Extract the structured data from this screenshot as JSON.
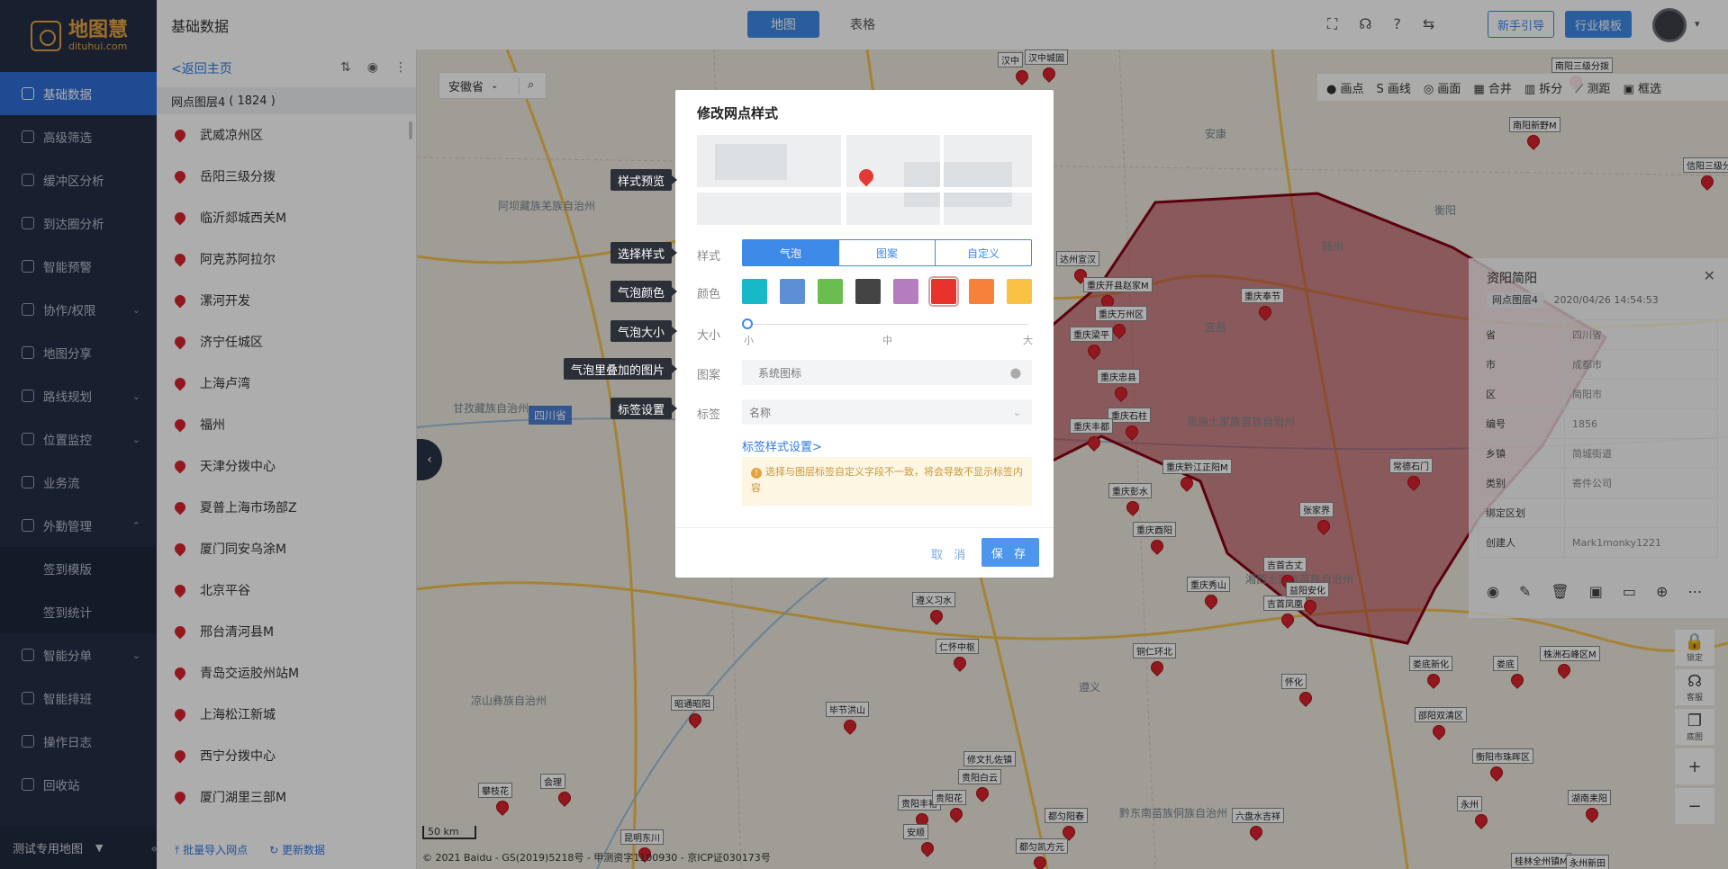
{
  "nav": {
    "logo": {
      "name": "地图慧",
      "sub": "dituhui.com"
    },
    "items": [
      {
        "label": "基础数据",
        "active": true
      },
      {
        "label": "高级筛选"
      },
      {
        "label": "缓冲区分析"
      },
      {
        "label": "到达圈分析"
      },
      {
        "label": "智能预警"
      },
      {
        "label": "协作/权限",
        "arrow": "⌄"
      },
      {
        "label": "地图分享"
      },
      {
        "label": "路线规划",
        "arrow": "⌄"
      },
      {
        "label": "位置监控",
        "arrow": "⌄"
      },
      {
        "label": "业务流"
      },
      {
        "label": "外勤管理",
        "arrow": "⌃"
      },
      {
        "label": "签到模版",
        "sub": true
      },
      {
        "label": "签到统计",
        "sub": true
      },
      {
        "label": "智能分单",
        "arrow": "⌄"
      },
      {
        "label": "智能排班"
      },
      {
        "label": "操作日志"
      },
      {
        "label": "回收站"
      }
    ],
    "map_name": "测试专用地图",
    "collapse": "«"
  },
  "topbar": {
    "title": "基础数据",
    "tabs": [
      {
        "label": "地图",
        "active": true
      },
      {
        "label": "表格"
      }
    ],
    "guide_btn": "新手引导",
    "template_btn": "行业模板"
  },
  "panel": {
    "back": "<返回主页",
    "layer_name": "网点图层4",
    "layer_count": "( 1824 )",
    "items": [
      "武威凉州区",
      "岳阳三级分拨",
      "临沂郯城西关M",
      "阿克苏阿拉尔",
      "漯河开发",
      "济宁任城区",
      "上海卢湾",
      "福州",
      "天津分拨中心",
      "夏普上海市场部Z",
      "厦门同安乌涂M",
      "北京平谷",
      "邢台清河县M",
      "青岛交运胶州站M",
      "上海松江新城",
      "西宁分拨中心",
      "厦门湖里三部M"
    ],
    "import": "批量导入网点",
    "refresh": "更新数据"
  },
  "map": {
    "province_select": "安徽省",
    "tools": [
      "画点",
      "画线",
      "画面",
      "合并",
      "拆分",
      "测距",
      "框选"
    ],
    "province_tag": "四川省",
    "region_labels": [
      "阿坝藏族羌族自治州",
      "甘孜藏族自治州",
      "凉山彝族自治州",
      "恩施土家族苗族自治州",
      "黔东南苗族侗族自治州",
      "安康",
      "湘西土家族苗族自治州",
      "随州",
      "宜昌",
      "衡阳",
      "遵义"
    ],
    "cities": [
      "汉中城固",
      "汉中",
      "达州宣汉",
      "重庆开县赵家M",
      "重庆奉节",
      "重庆万州区",
      "重庆梁平",
      "重庆忠县",
      "重庆石柱",
      "重庆丰都",
      "重庆彭水",
      "重庆黔江正阳M",
      "重庆酉阳",
      "重庆秀山",
      "吉首古丈",
      "吉首凤凰",
      "遵义习水",
      "仁怀中枢",
      "毕节洪山",
      "昭通昭阳",
      "六盘水吉祥",
      "修文扎佐镇",
      "贵阳白云",
      "贵阳丰裕",
      "都匀阳春",
      "都匀凯方元",
      "安顺",
      "贵阳花",
      "攀枝花",
      "会理",
      "昆明东川",
      "铜仁环北",
      "怀化",
      "张家界",
      "益阳安化",
      "常德石门",
      "娄底新化",
      "娄底",
      "邵阳双清区",
      "衡阳市珠晖区",
      "湖南耒阳",
      "永州",
      "株洲石峰区M",
      "信阳三级分拨",
      "南阳新野M",
      "南阳三级分拨",
      "桂林全州镇M",
      "永州新田"
    ],
    "scale": "50 km",
    "copyright": "© 2021 Baidu - GS(2019)5218号 - 甲测资字1100930 - 京ICP证030173号"
  },
  "infocard": {
    "title": "资阳简阳",
    "layer": "网点图层4",
    "date": "2020/04/26 14:54:53",
    "rows": [
      {
        "k": "省",
        "v": "四川省"
      },
      {
        "k": "市",
        "v": "成都市"
      },
      {
        "k": "区",
        "v": "简阳市"
      },
      {
        "k": "编号",
        "v": "1856"
      },
      {
        "k": "乡镇",
        "v": "简城街道"
      },
      {
        "k": "类别",
        "v": "寄件公司"
      },
      {
        "k": "绑定区划",
        "v": ""
      },
      {
        "k": "创建人",
        "v": "Mark1monky1221"
      }
    ]
  },
  "controls": {
    "lock": "锁定",
    "service": "客服",
    "bottom": "底图"
  },
  "modal": {
    "title": "修改网点样式",
    "style_label": "样式",
    "style_tabs": [
      {
        "label": "气泡",
        "active": true
      },
      {
        "label": "图案"
      },
      {
        "label": "自定义"
      }
    ],
    "color_label": "颜色",
    "colors": [
      "#17b8c8",
      "#5c8fd6",
      "#6abe4f",
      "#444444",
      "#b57cc0",
      "#e8322e",
      "#f5813a",
      "#f7c144"
    ],
    "selected_color": "#e8322e",
    "size_label": "大小",
    "size_marks": [
      "小",
      "中",
      "大"
    ],
    "size_value": 0,
    "icon_label": "图案",
    "icon_value": "系统图标",
    "tag_label": "标签",
    "tag_value": "名称",
    "tag_link": "标签样式设置>",
    "warning": "选择与图层标签自定义字段不一致，将会导致不显示标签内容",
    "cancel": "取 消",
    "save": "保 存"
  },
  "tips": [
    "样式预览",
    "选择样式",
    "气泡颜色",
    "气泡大小",
    "气泡里叠加的图片",
    "标签设置"
  ]
}
